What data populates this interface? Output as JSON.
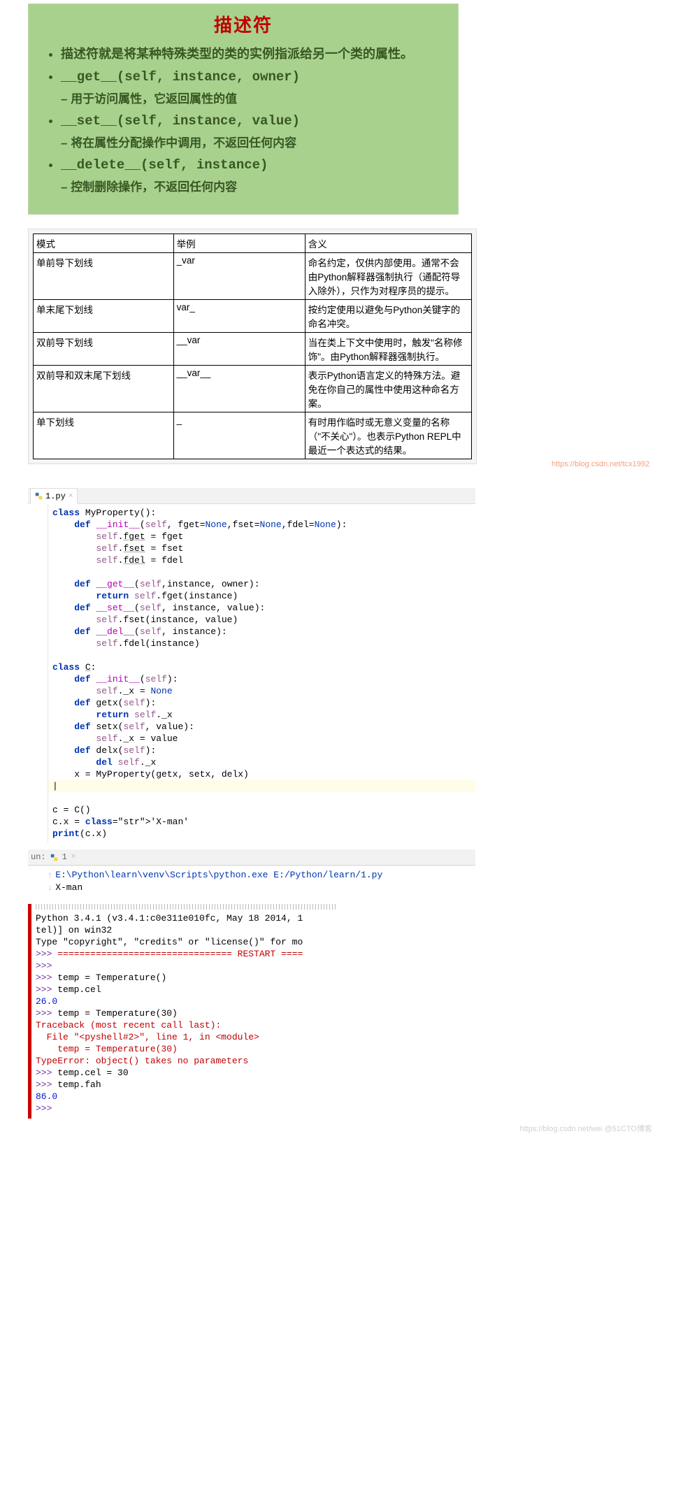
{
  "slide": {
    "title": "描述符",
    "intro": "描述符就是将某种特殊类型的类的实例指派给另一个类的属性。",
    "items": [
      {
        "sig": "__get__(self, instance, owner)",
        "sub": "用于访问属性，它返回属性的值"
      },
      {
        "sig": "__set__(self, instance, value)",
        "sub": "将在属性分配操作中调用，不返回任何内容"
      },
      {
        "sig": "__delete__(self, instance)",
        "sub": "控制删除操作，不返回任何内容"
      }
    ]
  },
  "table": {
    "headers": [
      "模式",
      "举例",
      "含义"
    ],
    "rows": [
      [
        "单前导下划线",
        "_var",
        "命名约定，仅供内部使用。通常不会由Python解释器强制执行（通配符导入除外），只作为对程序员的提示。"
      ],
      [
        "单末尾下划线",
        "var_",
        "按约定使用以避免与Python关键字的命名冲突。"
      ],
      [
        "双前导下划线",
        "__var",
        "当在类上下文中使用时，触发\"名称修饰\"。由Python解释器强制执行。"
      ],
      [
        "双前导和双末尾下划线",
        "__var__",
        "表示Python语言定义的特殊方法。避免在你自己的属性中使用这种命名方案。"
      ],
      [
        "单下划线",
        "_",
        "有时用作临时或无意义变量的名称（\"不关心\"）。也表示Python REPL中最近一个表达式的结果。"
      ]
    ],
    "watermark": "https://blog.csdn.net/tcx1992"
  },
  "editor": {
    "tab_name": "1.py",
    "code_lines": [
      {
        "i": 0,
        "t": "class MyProperty():"
      },
      {
        "i": 1,
        "t": "def __init__(self, fget=None,fset=None,fdel=None):"
      },
      {
        "i": 2,
        "t": "self.fget = fget"
      },
      {
        "i": 2,
        "t": "self.fset = fset"
      },
      {
        "i": 2,
        "t": "self.fdel = fdel"
      },
      {
        "i": 0,
        "t": ""
      },
      {
        "i": 1,
        "t": "def __get__(self,instance, owner):"
      },
      {
        "i": 2,
        "t": "return self.fget(instance)"
      },
      {
        "i": 1,
        "t": "def __set__(self, instance, value):"
      },
      {
        "i": 2,
        "t": "self.fset(instance, value)"
      },
      {
        "i": 1,
        "t": "def __del__(self, instance):"
      },
      {
        "i": 2,
        "t": "self.fdel(instance)"
      },
      {
        "i": 0,
        "t": ""
      },
      {
        "i": 0,
        "t": "class C:"
      },
      {
        "i": 1,
        "t": "def __init__(self):"
      },
      {
        "i": 2,
        "t": "self._x = None"
      },
      {
        "i": 1,
        "t": "def getx(self):"
      },
      {
        "i": 2,
        "t": "return self._x"
      },
      {
        "i": 1,
        "t": "def setx(self, value):"
      },
      {
        "i": 2,
        "t": "self._x = value"
      },
      {
        "i": 1,
        "t": "def delx(self):"
      },
      {
        "i": 2,
        "t": "del self._x"
      },
      {
        "i": 1,
        "t": "x = MyProperty(getx, setx, delx)"
      },
      {
        "i": 0,
        "t": "<CARET>"
      },
      {
        "i": 0,
        "t": "c = C()"
      },
      {
        "i": 0,
        "t": "c.x = 'X-man'"
      },
      {
        "i": 0,
        "t": "print(c.x)"
      }
    ]
  },
  "run": {
    "label": "un:",
    "tab": "1",
    "path_line": "E:\\Python\\learn\\venv\\Scripts\\python.exe E:/Python/learn/1.py",
    "output": "X-man"
  },
  "repl": {
    "lines": [
      {
        "c": "black",
        "t": "Python 3.4.1 (v3.4.1:c0e311e010fc, May 18 2014, 1"
      },
      {
        "c": "black",
        "t": "tel)] on win32"
      },
      {
        "c": "black",
        "t": "Type \"copyright\", \"credits\" or \"license()\" for mo"
      },
      {
        "c": "purple",
        "t": ">>> "
      },
      {
        "c": "red-inline",
        "t": "================================ RESTART ===="
      },
      {
        "c": "purple",
        "t": ">>> "
      },
      {
        "c": "black-inline",
        "t": ""
      },
      {
        "c": "purple",
        "t": ">>> "
      },
      {
        "c": "black-inline",
        "t": "temp = Temperature()"
      },
      {
        "c": "purple",
        "t": ">>> "
      },
      {
        "c": "black-inline",
        "t": "temp.cel"
      },
      {
        "c": "blue",
        "t": "26.0"
      },
      {
        "c": "purple",
        "t": ">>> "
      },
      {
        "c": "black-inline",
        "t": "temp = Temperature(30)"
      },
      {
        "c": "red",
        "t": "Traceback (most recent call last):"
      },
      {
        "c": "red",
        "t": "  File \"<pyshell#2>\", line 1, in <module>"
      },
      {
        "c": "red",
        "t": "    temp = Temperature(30)"
      },
      {
        "c": "red",
        "t": "TypeError: object() takes no parameters"
      },
      {
        "c": "purple",
        "t": ">>> "
      },
      {
        "c": "black-inline",
        "t": "temp.cel = 30"
      },
      {
        "c": "purple",
        "t": ">>> "
      },
      {
        "c": "black-inline",
        "t": "temp.fah"
      },
      {
        "c": "blue",
        "t": "86.0"
      },
      {
        "c": "purple",
        "t": ">>> "
      },
      {
        "c": "black-inline",
        "t": ""
      }
    ]
  },
  "watermark2": "https://blog.csdn.net/wei  @51CTO博客"
}
